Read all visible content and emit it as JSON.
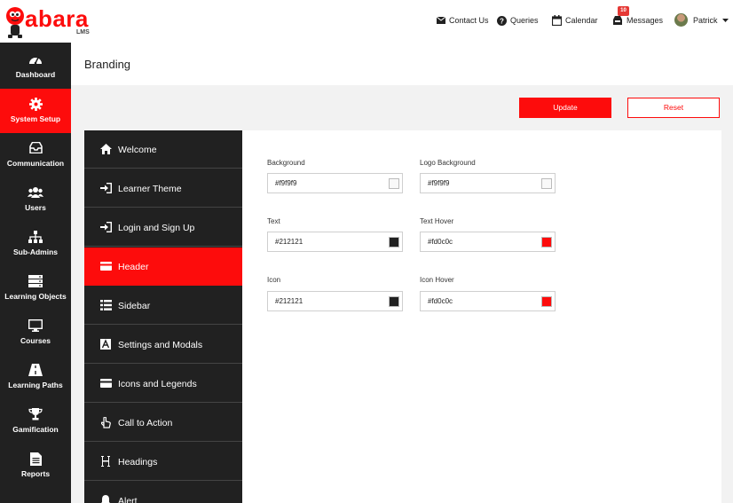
{
  "brand": {
    "name": "abara",
    "sub": "LMS",
    "accent": "#fd0c0c",
    "dark": "#212121"
  },
  "topnav": {
    "contact": "Contact Us",
    "queries": "Queries",
    "calendar": "Calendar",
    "messages": "Messages",
    "messages_badge": "10",
    "user": "Patrick"
  },
  "sidebar": {
    "items": [
      {
        "label": "Dashboard",
        "icon": "dashboard-icon"
      },
      {
        "label": "System Setup",
        "icon": "gear-icon"
      },
      {
        "label": "Communication",
        "icon": "inbox-icon"
      },
      {
        "label": "Users",
        "icon": "users-icon"
      },
      {
        "label": "Sub-Admins",
        "icon": "sitemap-icon"
      },
      {
        "label": "Learning Objects",
        "icon": "server-icon"
      },
      {
        "label": "Courses",
        "icon": "monitor-icon"
      },
      {
        "label": "Learning Paths",
        "icon": "road-icon"
      },
      {
        "label": "Gamification",
        "icon": "trophy-icon"
      },
      {
        "label": "Reports",
        "icon": "file-icon"
      }
    ]
  },
  "page": {
    "title": "Branding"
  },
  "actions": {
    "update": "Update",
    "reset": "Reset"
  },
  "menu": {
    "items": [
      {
        "label": "Welcome",
        "icon": "home-icon"
      },
      {
        "label": "Learner Theme",
        "icon": "sign-in-icon"
      },
      {
        "label": "Login and Sign Up",
        "icon": "sign-in-icon"
      },
      {
        "label": "Header",
        "icon": "card-icon"
      },
      {
        "label": "Sidebar",
        "icon": "list-icon"
      },
      {
        "label": "Settings and Modals",
        "icon": "font-icon"
      },
      {
        "label": "Icons and Legends",
        "icon": "card-icon"
      },
      {
        "label": "Call to Action",
        "icon": "pointer-icon"
      },
      {
        "label": "Headings",
        "icon": "heading-icon"
      },
      {
        "label": "Alert",
        "icon": "bell-icon"
      }
    ]
  },
  "fields": {
    "background": {
      "label": "Background",
      "value": "#f9f9f9",
      "color": "#f9f9f9"
    },
    "logo_background": {
      "label": "Logo Background",
      "value": "#f9f9f9",
      "color": "#f9f9f9"
    },
    "text": {
      "label": "Text",
      "value": "#212121",
      "color": "#212121"
    },
    "text_hover": {
      "label": "Text Hover",
      "value": "#fd0c0c",
      "color": "#fd0c0c"
    },
    "icon": {
      "label": "Icon",
      "value": "#212121",
      "color": "#212121"
    },
    "icon_hover": {
      "label": "Icon Hover",
      "value": "#fd0c0c",
      "color": "#fd0c0c"
    }
  }
}
